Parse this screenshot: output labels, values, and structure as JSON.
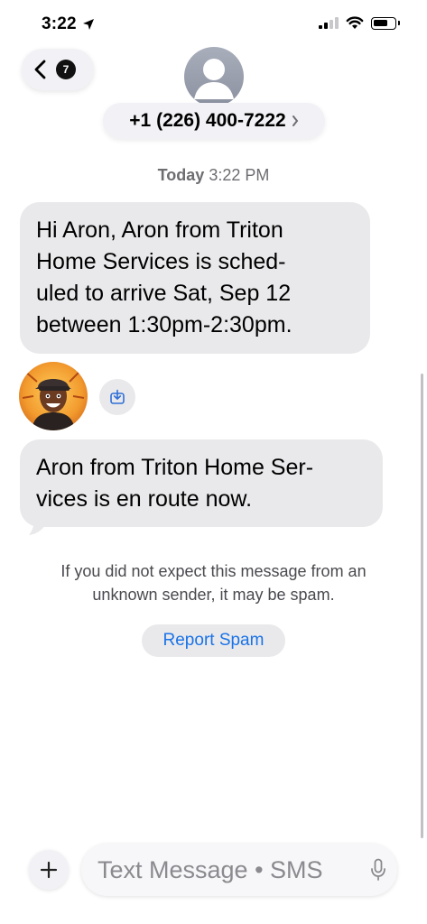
{
  "status_bar": {
    "time": "3:22"
  },
  "header": {
    "back_badge": "7",
    "contact_number": "+1 (226) 400-7222"
  },
  "thread": {
    "timestamp_day": "Today",
    "timestamp_time": "3:22 PM",
    "messages": [
      {
        "lines": [
          "Hi Aron,   Aron from Triton",
          "Home Services is sched-",
          "uled to arrive Sat, Sep 12",
          "between 1:30pm-2:30pm."
        ]
      },
      {
        "lines": [
          "Aron from Triton Home Ser-",
          "vices is en route now."
        ]
      }
    ],
    "spam_notice_lines": [
      "If you did not expect this message from an",
      "unknown sender, it may be spam."
    ],
    "report_spam_label": "Report Spam"
  },
  "composer": {
    "placeholder": "Text Message • SMS"
  },
  "colors": {
    "bubble_gray": "#e9e9eb",
    "link_blue": "#1a73e8",
    "avatar_orange": "#e88b2a"
  },
  "icons": [
    "location-arrow-icon",
    "signal-icon",
    "wifi-icon",
    "battery-icon",
    "back-chevron-icon",
    "person-icon",
    "chevron-right-icon",
    "save-icon",
    "plus-icon",
    "mic-icon"
  ]
}
